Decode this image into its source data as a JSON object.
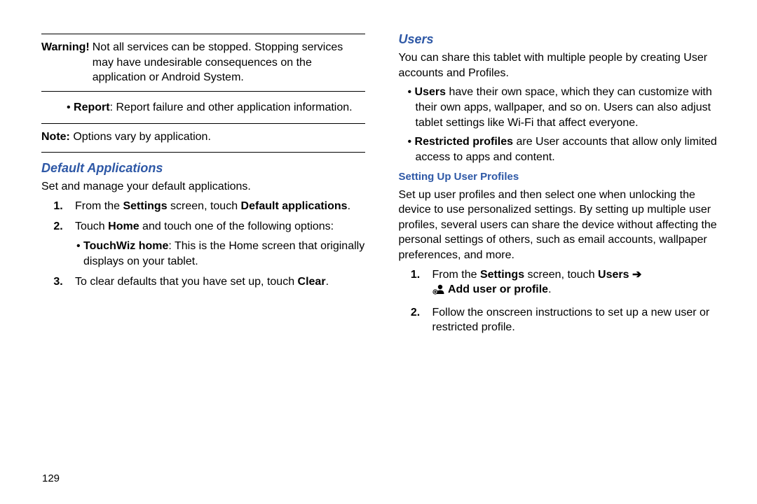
{
  "left": {
    "warning_label": "Warning!",
    "warning_text": "Not all services can be stopped. Stopping services may have undesirable consequences on the application or Android System.",
    "report_label": "Report",
    "report_text": ": Report failure and other application information.",
    "note_label": "Note:",
    "note_text": " Options vary by application.",
    "section_title": "Default Applications",
    "intro": "Set and manage your default applications.",
    "step1_pre": "From the ",
    "step1_b1": "Settings",
    "step1_mid": " screen, touch ",
    "step1_b2": "Default applications",
    "step1_post": ".",
    "step2_pre": "Touch ",
    "step2_b": "Home",
    "step2_post": " and touch one of the following options:",
    "step2_sub_b": "TouchWiz home",
    "step2_sub_text": ": This is the Home screen that originally displays on your tablet.",
    "step3_pre": "To clear defaults that you have set up, touch ",
    "step3_b": "Clear",
    "step3_post": "."
  },
  "right": {
    "section_title": "Users",
    "intro": "You can share this tablet with multiple people by creating User accounts and Profiles.",
    "b1_label": "Users",
    "b1_text": " have their own space, which they can customize with their own apps, wallpaper, and so on. Users can also adjust tablet settings like Wi-Fi that affect everyone.",
    "b2_label": "Restricted profiles",
    "b2_text": " are User accounts that allow only limited access to apps and content.",
    "subsection": "Setting Up User Profiles",
    "sub_intro": "Set up user profiles and then select one when unlocking the device to use personalized settings. By setting up multiple user profiles, several users can share the device without affecting the personal settings of others, such as email accounts, wallpaper preferences, and more.",
    "s1_pre": "From the ",
    "s1_b1": "Settings",
    "s1_mid": " screen, touch ",
    "s1_b2": "Users",
    "s1_arrow": " ➔",
    "s1_add": "Add user or profile",
    "s1_post": ".",
    "s2": "Follow the onscreen instructions to set up a new user or restricted profile."
  },
  "page_number": "129"
}
